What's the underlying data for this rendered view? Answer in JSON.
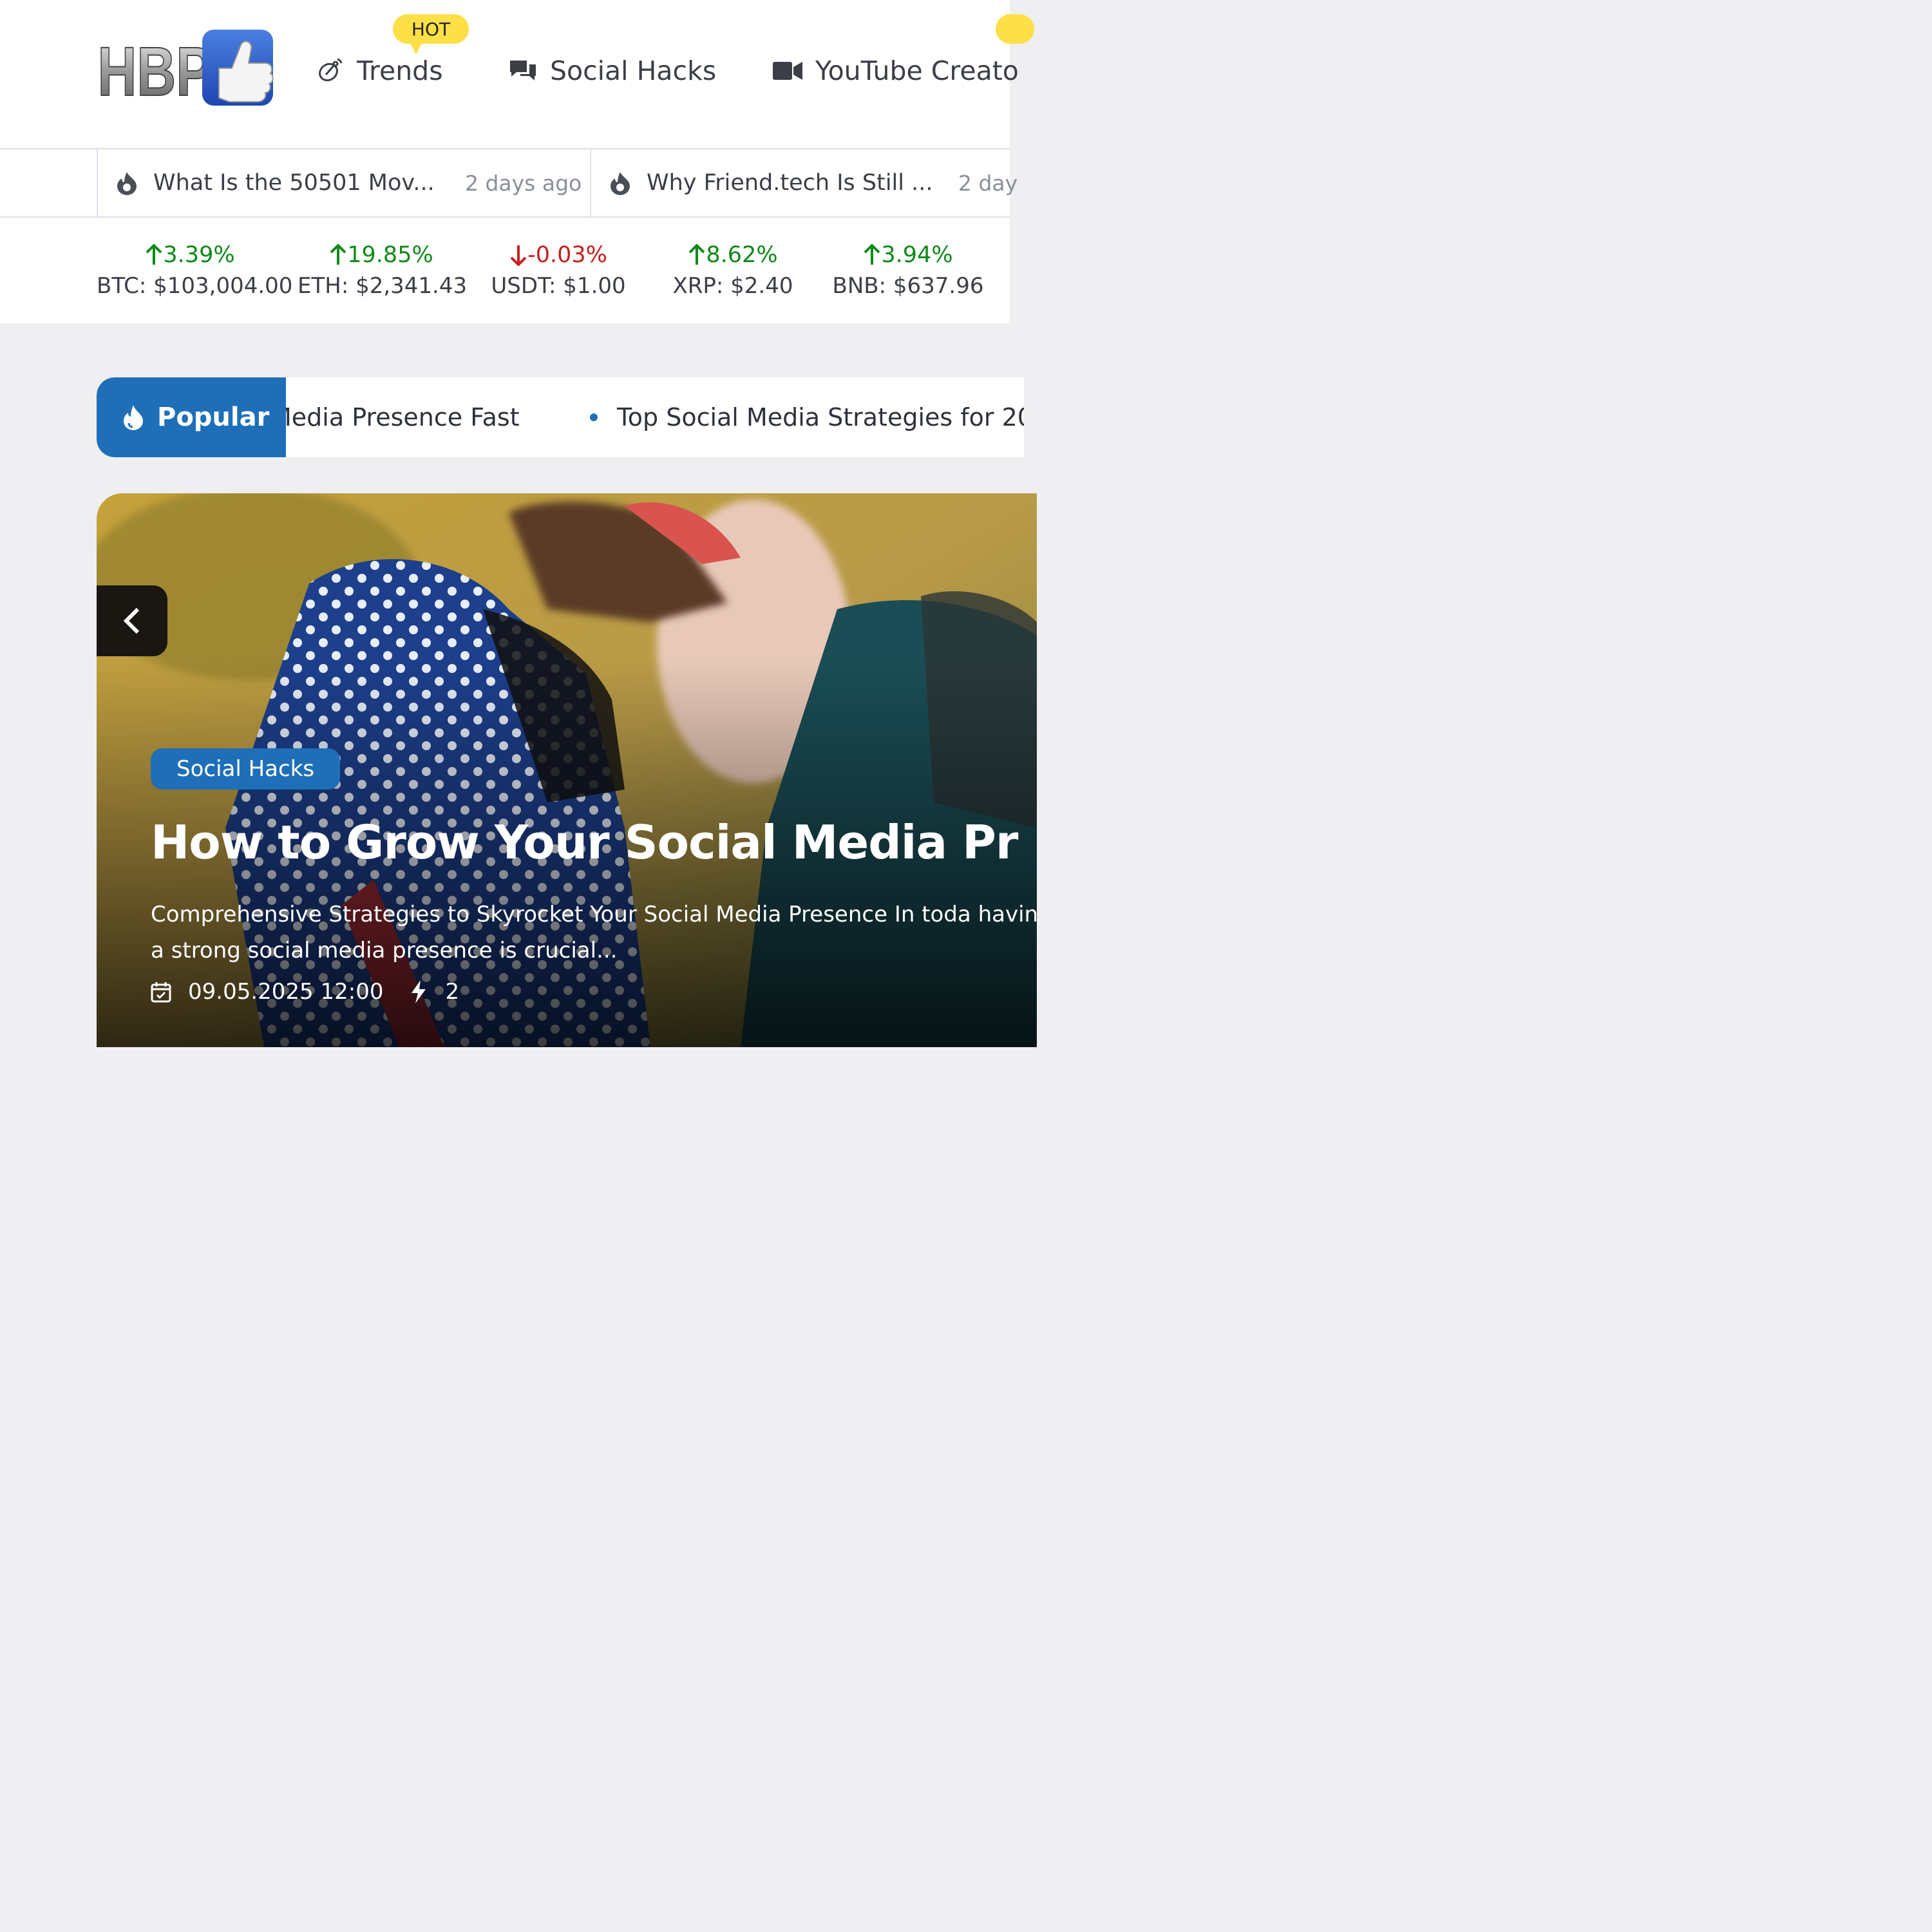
{
  "header": {
    "logo_alt": "HBP",
    "hot_badge": "HOT",
    "nav": [
      {
        "label": "Trends",
        "icon": "satellite-dish-icon"
      },
      {
        "label": "Social Hacks",
        "icon": "chat-bubbles-icon"
      },
      {
        "label": "YouTube Creato",
        "icon": "video-camera-icon"
      }
    ]
  },
  "ticker": [
    {
      "title": "What Is the 50501 Mov...",
      "time": "2 days ago"
    },
    {
      "title": "Why Friend.tech Is Still ...",
      "time": "2 day"
    }
  ],
  "crypto": [
    {
      "change": "3.39%",
      "direction": "up",
      "price": "BTC: $103,004.00"
    },
    {
      "change": "19.85%",
      "direction": "up",
      "price": "ETH: $2,341.43"
    },
    {
      "change": "-0.03%",
      "direction": "down",
      "price": "USDT: $1.00"
    },
    {
      "change": "8.62%",
      "direction": "up",
      "price": "XRP: $2.40"
    },
    {
      "change": "3.94%",
      "direction": "up",
      "price": "BNB: $637.96"
    }
  ],
  "popular": {
    "label": "Popular",
    "items": [
      "Media Presence Fast",
      "Top Social Media Strategies for 20"
    ]
  },
  "hero": {
    "category": "Social Hacks",
    "title": "How to Grow Your Social Media Pr",
    "description": "Comprehensive Strategies to Skyrocket Your Social Media Presence In toda having a strong social media presence is crucial...",
    "date": "09.05.2025 12:00",
    "count": "2"
  },
  "colors": {
    "accent": "#1f6fb8",
    "up": "#0f8a17",
    "down": "#c81e1e",
    "hot": "#fde047"
  }
}
